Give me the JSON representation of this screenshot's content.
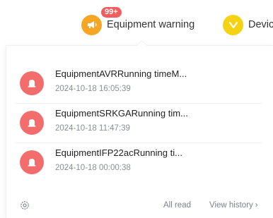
{
  "tabs": {
    "warning": {
      "label": "Equipment warning",
      "badge": "99+"
    },
    "device": {
      "label": "Devic"
    }
  },
  "notifications": [
    {
      "title": "EquipmentAVRRunning timeM...",
      "time": "2024-10-18 16:05:39"
    },
    {
      "title": "EquipmentSRKGARunning tim...",
      "time": "2024-10-18 11:47:39"
    },
    {
      "title": "EquipmentIFP22acRunning ti...",
      "time": "2024-10-18 00:00:38"
    }
  ],
  "footer": {
    "all_read": "All read",
    "view_history": "View history",
    "chevron": "›"
  },
  "colors": {
    "warning_icon": "#f6a623",
    "device_icon": "#f5d312",
    "badge": "#f25d5d",
    "alarm_icon": "#f46d6d"
  }
}
